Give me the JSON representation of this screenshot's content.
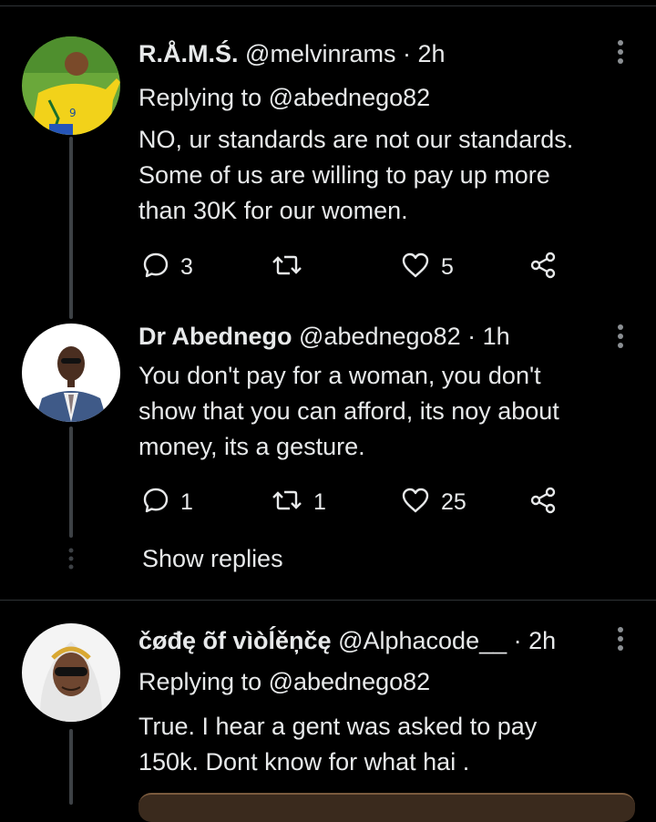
{
  "tweets": [
    {
      "name": "R.Å.M.Ś.",
      "handle": "@melvinrams",
      "separator": "·",
      "time": "2h",
      "replying_to": "Replying to @abednego82",
      "text_lines": [
        "NO, ur standards are not our standards.",
        "Some of us are willing to pay up more",
        "than 30K for our women."
      ],
      "reply_count": "3",
      "retweet_count": "",
      "like_count": "5"
    },
    {
      "name": "Dr Abednego",
      "handle": "@abednego82",
      "separator": "·",
      "time": "1h",
      "text_lines": [
        "You don't pay for a woman, you don't",
        "show that you can afford, its noy about",
        "money, its a gesture."
      ],
      "reply_count": "1",
      "retweet_count": "1",
      "like_count": "25"
    },
    {
      "name": "čøđę õf vìòĺěņčę",
      "handle": "@Alphacode__",
      "separator": "·",
      "time": "2h",
      "replying_to": "Replying to @abednego82",
      "text_lines": [
        "True. I hear a gent was asked to pay",
        "150k. Dont know for what hai ."
      ]
    }
  ],
  "show_replies_label": "Show replies",
  "icons": {
    "reply": "reply-bubble-icon",
    "retweet": "retweet-icon",
    "like": "heart-icon",
    "share": "share-icon",
    "more": "more-vertical-icon"
  },
  "colors": {
    "background": "#000000",
    "text": "#e7e9ea",
    "icon": "#e7e9ea",
    "thread_line": "#3d4145",
    "divider": "#2f3336"
  }
}
